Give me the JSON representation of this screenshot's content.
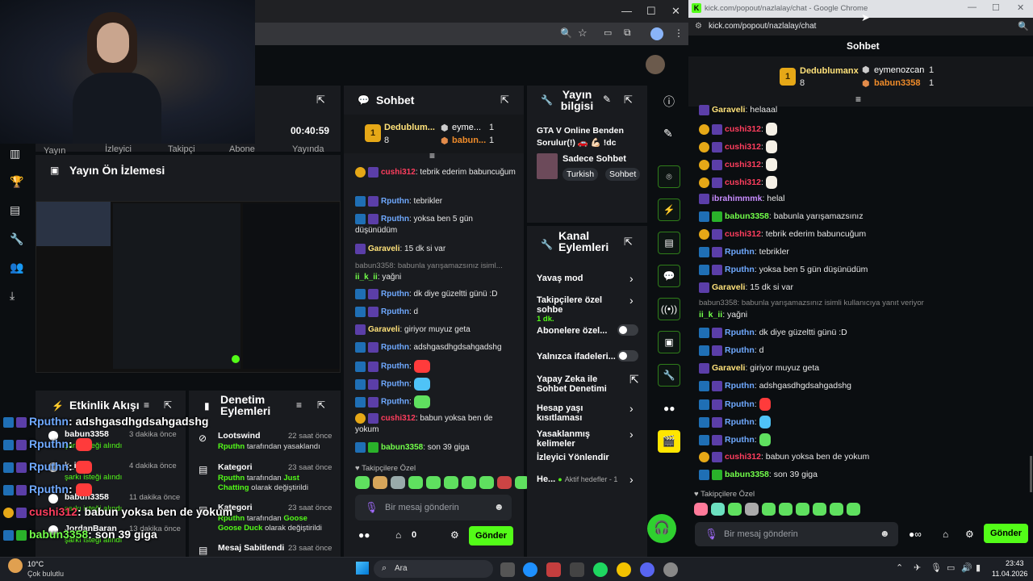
{
  "left_window": {
    "tab_labels": {
      "yayin": "Yayın",
      "izleyici": "İzleyici",
      "takipci": "Takipçi",
      "abone": "Abone",
      "yayinda": "Yayında"
    },
    "time": "00:40:59",
    "preview_title": "Yayın Ön İzlemesi",
    "chat_title": "Sohbet",
    "stream_info_title": "Yayın bilgisi",
    "stream_title_text": "GTA V Online Benden Sorulur(!) 🚗 💪🏻 !dc",
    "category": "Sadece Sohbet",
    "tags": [
      "Turkish",
      "Sohbet"
    ],
    "channel_actions_title": "Kanal Eylemleri",
    "actions": [
      {
        "label": "Yavaş mod"
      },
      {
        "label": "Takipçilere özel sohbe",
        "sub": "1 dk."
      },
      {
        "label": "Abonelere özel..."
      },
      {
        "label": "Yalnızca ifadeleri..."
      },
      {
        "label": "Yapay Zeka ile Sohbet Denetimi"
      },
      {
        "label": "Hesap yaşı kısıtlaması"
      },
      {
        "label": "Yasaklanmış kelimeler"
      },
      {
        "label": "İzleyici Yönlendir"
      },
      {
        "label": "He...",
        "sub": "Aktif hedefler - 1"
      }
    ],
    "leaderboard": [
      {
        "name": "Dedublum...",
        "count": "8"
      },
      {
        "name": "eyme...",
        "count": "1"
      },
      {
        "name": "babun...",
        "count": "1"
      }
    ],
    "chat": [
      {
        "user": "cushi312",
        "text": ": tebrik ederim babuncuğum"
      },
      {
        "user": "Rputhn",
        "text": ": tebrikler"
      },
      {
        "user": "Rputhn",
        "text": ": yoksa ben 5 gün düşünüdüm"
      },
      {
        "user": "Garaveli",
        "text": ": 15 dk si var"
      },
      {
        "reply": "babun3358: babunla yarışamazsınız isiml...",
        "user": "ii_k_ii",
        "text": ": yağni"
      },
      {
        "user": "Rputhn",
        "text": ": dk diye güzeltti günü :D"
      },
      {
        "user": "Rputhn",
        "text": ": d"
      },
      {
        "user": "Garaveli",
        "text": ": giriyor muyuz geta"
      },
      {
        "user": "Rputhn",
        "text": ": adshgasdhgdsahgadshg"
      },
      {
        "user": "Rputhn",
        "text": ":"
      },
      {
        "user": "Rputhn",
        "text": ":"
      },
      {
        "user": "Rputhn",
        "text": ":"
      },
      {
        "user": "cushi312",
        "text": ": babun yoksa ben de yokum"
      },
      {
        "user": "babun3358",
        "text": ": son 39 giga"
      }
    ],
    "followers_only": "Takipçilere Özel",
    "input_placeholder": "Bir mesaj gönderin",
    "viewer_count": "0",
    "send_label": "Gönder",
    "activity_title": "Etkinlik Akışı",
    "activity": [
      {
        "user": "babun3358",
        "time": "3 dakika önce",
        "note": "şarkı isteği alındı"
      },
      {
        "user": "k_ii",
        "time": "4 dakika önce",
        "note": "şarkı isteği alındı"
      },
      {
        "user": "babun3358",
        "time": "11 dakika önce",
        "note": "şarkı isteği alındı"
      },
      {
        "user": "JordanBaran",
        "time": "13 dakika önce",
        "note": "şarkı isteği alındı"
      }
    ],
    "audit_title": "Denetim Eylemleri",
    "audit": [
      {
        "title": "Lootswind",
        "time": "22 saat önce",
        "actor": "Rputhn",
        "desc": "tarafından yasaklandı"
      },
      {
        "title": "Kategori",
        "time": "23 saat önce",
        "actor": "Rputhn",
        "desc": "tarafından",
        "target": "Just Chatting",
        "desc2": "olarak değiştirildi"
      },
      {
        "title": "Kategori",
        "time": "23 saat önce",
        "actor": "Rputhn",
        "desc": "tarafından",
        "target": "Goose Goose Duck",
        "desc2": "olarak değiştirildi"
      },
      {
        "title": "Mesaj Sabitlendi",
        "time": "23 saat önce"
      }
    ]
  },
  "right_window": {
    "window_title": "kick.com/popout/nazlalay/chat - Google Chrome",
    "url": "kick.com/popout/nazlalay/chat",
    "header": "Sohbet",
    "leaderboard": [
      {
        "name": "Dedublumanx",
        "count": "8"
      },
      {
        "name": "eymenozcan",
        "count": "1"
      },
      {
        "name": "babun3358",
        "count": "1"
      }
    ],
    "chat": [
      {
        "user": "Garaveli",
        "text": ": helaaal"
      },
      {
        "user": "cushi312",
        "text": ":"
      },
      {
        "user": "cushi312",
        "text": ":"
      },
      {
        "user": "cushi312",
        "text": ":"
      },
      {
        "user": "cushi312",
        "text": ":"
      },
      {
        "user": "ibrahimmmk",
        "text": ": helal"
      },
      {
        "user": "babun3358",
        "text": ": babunla yarışamazsınız"
      },
      {
        "user": "cushi312",
        "text": ": tebrik ederim babuncuğum"
      },
      {
        "user": "Rputhn",
        "text": ": tebrikler"
      },
      {
        "user": "Rputhn",
        "text": ": yoksa ben 5 gün düşünüdüm"
      },
      {
        "user": "Garaveli",
        "text": ": 15 dk si var"
      },
      {
        "reply": "babun3358: babunla yarışamazsınız isimli kullanıcıya yanıt veriyor",
        "user": "ii_k_ii",
        "text": ": yağni"
      },
      {
        "user": "Rputhn",
        "text": ": dk diye güzeltti günü :D"
      },
      {
        "user": "Rputhn",
        "text": ": d"
      },
      {
        "user": "Garaveli",
        "text": ": giriyor muyuz geta"
      },
      {
        "user": "Rputhn",
        "text": ": adshgasdhgdsahgadshg"
      },
      {
        "user": "Rputhn",
        "text": ":"
      },
      {
        "user": "Rputhn",
        "text": ":"
      },
      {
        "user": "Rputhn",
        "text": ":"
      },
      {
        "user": "cushi312",
        "text": ": babun yoksa ben de yokum"
      },
      {
        "user": "babun3358",
        "text": ": son 39 giga"
      }
    ],
    "followers_only": "Takipçilere Özel",
    "input_placeholder": "Bir mesaj gönderin",
    "send_label": "Gönder"
  },
  "overlay": [
    {
      "user": "Rputhn",
      "text": ": adshgasdhgdsahgadshg"
    },
    {
      "user": "Rputhn",
      "text": ":"
    },
    {
      "user": "Rputhn",
      "text": ":"
    },
    {
      "user": "Rputhn",
      "text": ":"
    },
    {
      "user": "cushi312",
      "text": ": babun yoksa ben de yokum"
    },
    {
      "user": "babun3358",
      "text": ": son 39 giga"
    }
  ],
  "taskbar": {
    "weather_temp": "10°C",
    "weather_desc": "Çok bulutlu",
    "search": "Ara",
    "time": "23:43",
    "date": "11.04.2026"
  }
}
